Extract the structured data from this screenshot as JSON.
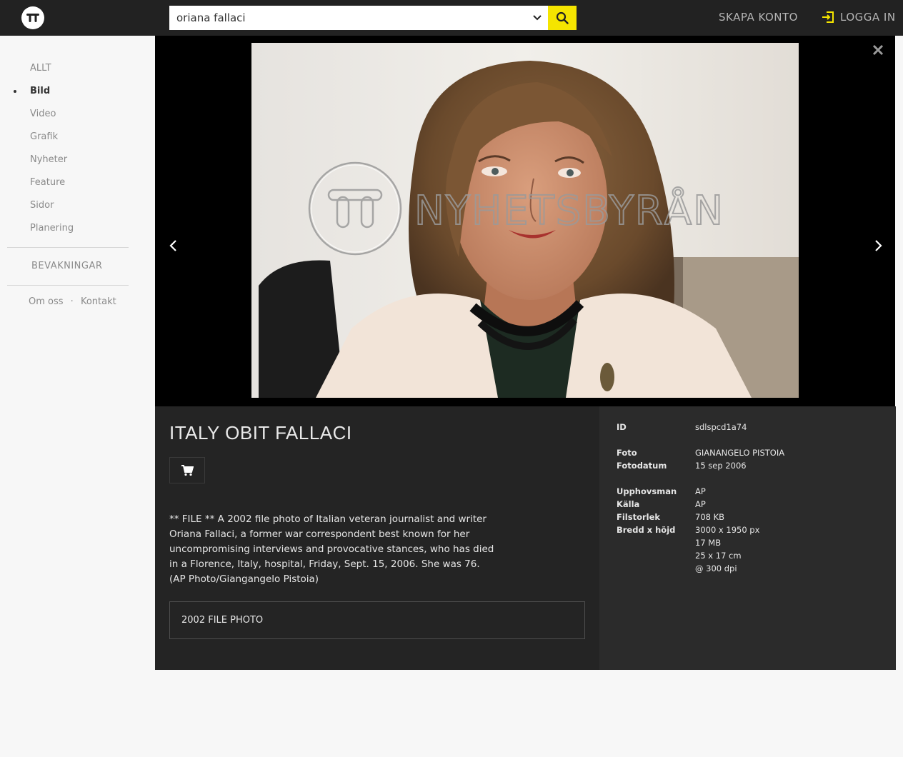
{
  "header": {
    "search_value": "oriana fallaci",
    "create_account": "SKAPA KONTO",
    "login": "LOGGA IN"
  },
  "sidebar": {
    "items": [
      {
        "label": "ALLT"
      },
      {
        "label": "Bild",
        "active": true
      },
      {
        "label": "Video"
      },
      {
        "label": "Grafik"
      },
      {
        "label": "Nyheter"
      },
      {
        "label": "Feature"
      },
      {
        "label": "Sidor"
      },
      {
        "label": "Planering"
      }
    ],
    "watch": "BEVAKNINGAR",
    "about": "Om oss",
    "dot": "·",
    "contact": "Kontakt"
  },
  "viewer": {
    "watermark": "NYHETSBYRÅN"
  },
  "detail": {
    "title": "ITALY OBIT FALLACI",
    "description": "** FILE ** A 2002 file photo of Italian veteran journalist and writer Oriana Fallaci, a former war correspondent best known for her uncompromising interviews and provocative stances, who has died in a Florence, Italy, hospital, Friday, Sept. 15, 2006. She was 76. (AP Photo/Giangangelo Pistoia)",
    "tag": "2002 FILE PHOTO"
  },
  "meta": {
    "id_label": "ID",
    "id_value": "sdlspcd1a74",
    "foto_label": "Foto",
    "foto_value": "GIANANGELO PISTOIA",
    "date_label": "Fotodatum",
    "date_value": "15 sep 2006",
    "author_label": "Upphovsman",
    "author_value": "AP",
    "source_label": "Källa",
    "source_value": "AP",
    "size_label": "Filstorlek",
    "size_value": "708 KB",
    "dims_label": "Bredd x höjd",
    "dims_value": "3000 x 1950 px",
    "mb_value": "17 MB",
    "cm_value": "25 x 17 cm",
    "dpi_value": "@ 300 dpi"
  },
  "colors": {
    "topbar": "#222222",
    "accent": "#f5e500",
    "panel_left": "#242424",
    "panel_right": "#2b2b2b"
  }
}
